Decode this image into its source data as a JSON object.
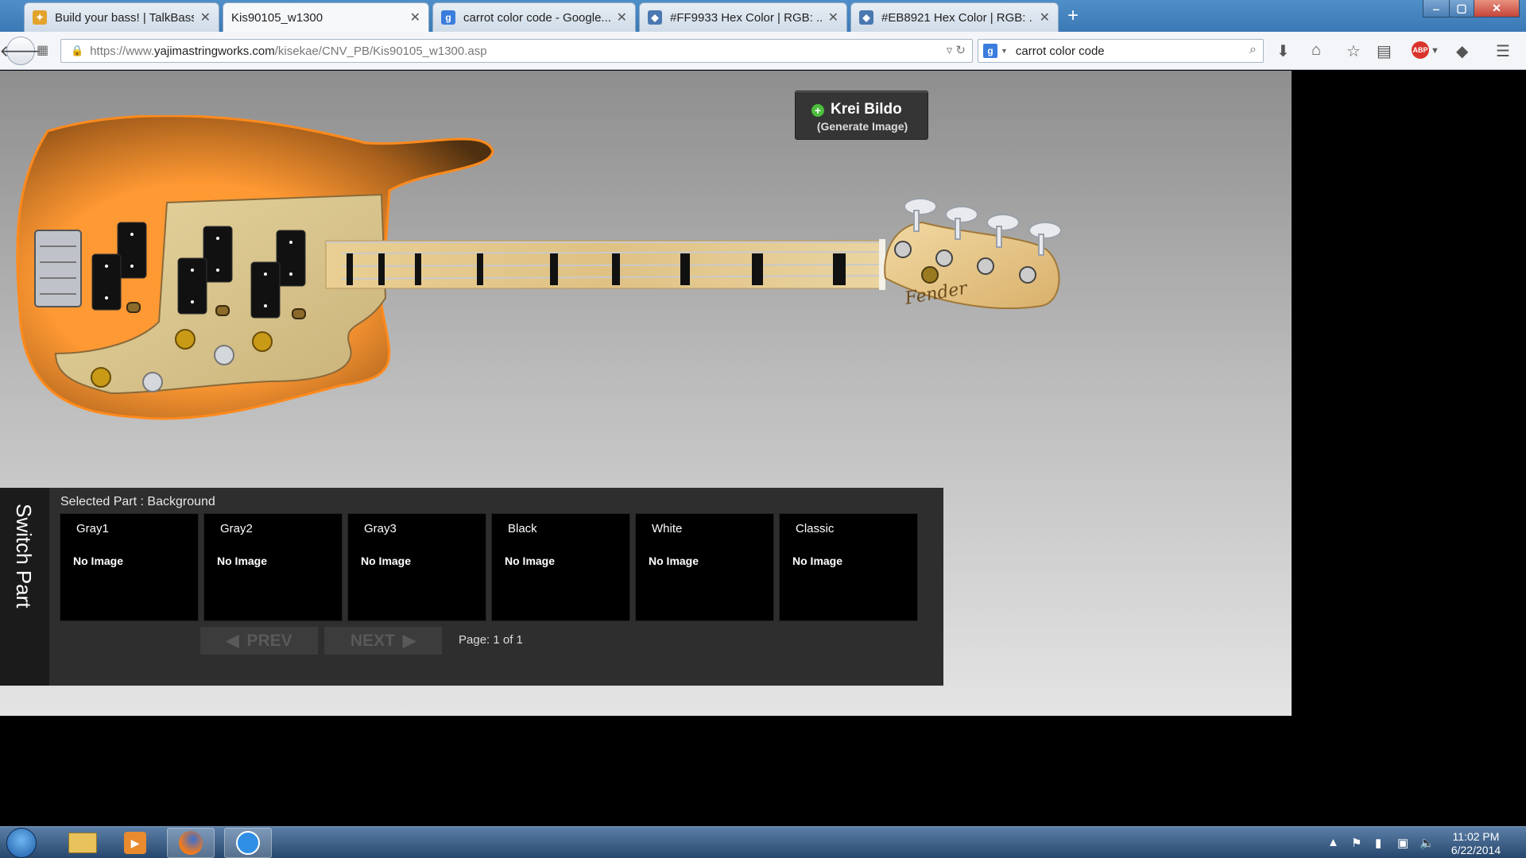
{
  "browser": {
    "tabs": [
      {
        "title": "Build your bass! | TalkBass....",
        "active": false
      },
      {
        "title": "Kis90105_w1300",
        "active": true
      },
      {
        "title": "carrot color code - Google...",
        "active": false
      },
      {
        "title": "#FF9933 Hex Color | RGB: ...",
        "active": false
      },
      {
        "title": "#EB8921 Hex Color | RGB: ...",
        "active": false
      }
    ],
    "new_tab": "+",
    "window_buttons": {
      "minimize": "‒",
      "maximize": "▢",
      "close": "✕"
    },
    "url_prefix": "https://www.",
    "url_host": "yajimastringworks.com",
    "url_path": "/kisekae/CNV_PB/Kis90105_w1300.asp",
    "search_value": "carrot color code",
    "search_engine_glyph": "g"
  },
  "generate_button": {
    "title": "Krei Bildo",
    "subtitle": "(Generate Image)"
  },
  "panel": {
    "switch_label": "Switch Part",
    "selected_part": "Selected Part : Background",
    "cards": [
      {
        "name": "Gray1",
        "image": "No Image"
      },
      {
        "name": "Gray2",
        "image": "No Image"
      },
      {
        "name": "Gray3",
        "image": "No Image"
      },
      {
        "name": "Black",
        "image": "No Image"
      },
      {
        "name": "White",
        "image": "No Image"
      },
      {
        "name": "Classic",
        "image": "No Image"
      }
    ],
    "prev_label": "PREV",
    "next_label": "NEXT",
    "page_info": "Page: 1 of 1"
  },
  "bass": {
    "body_color": "#FF9933",
    "burst_color": "#5a3a14",
    "pickguard_color": "#d8c48e",
    "neck_color": "#e6c98a",
    "headstock_logo": "Fender"
  },
  "taskbar": {
    "time": "11:02 PM",
    "date": "6/22/2014"
  }
}
